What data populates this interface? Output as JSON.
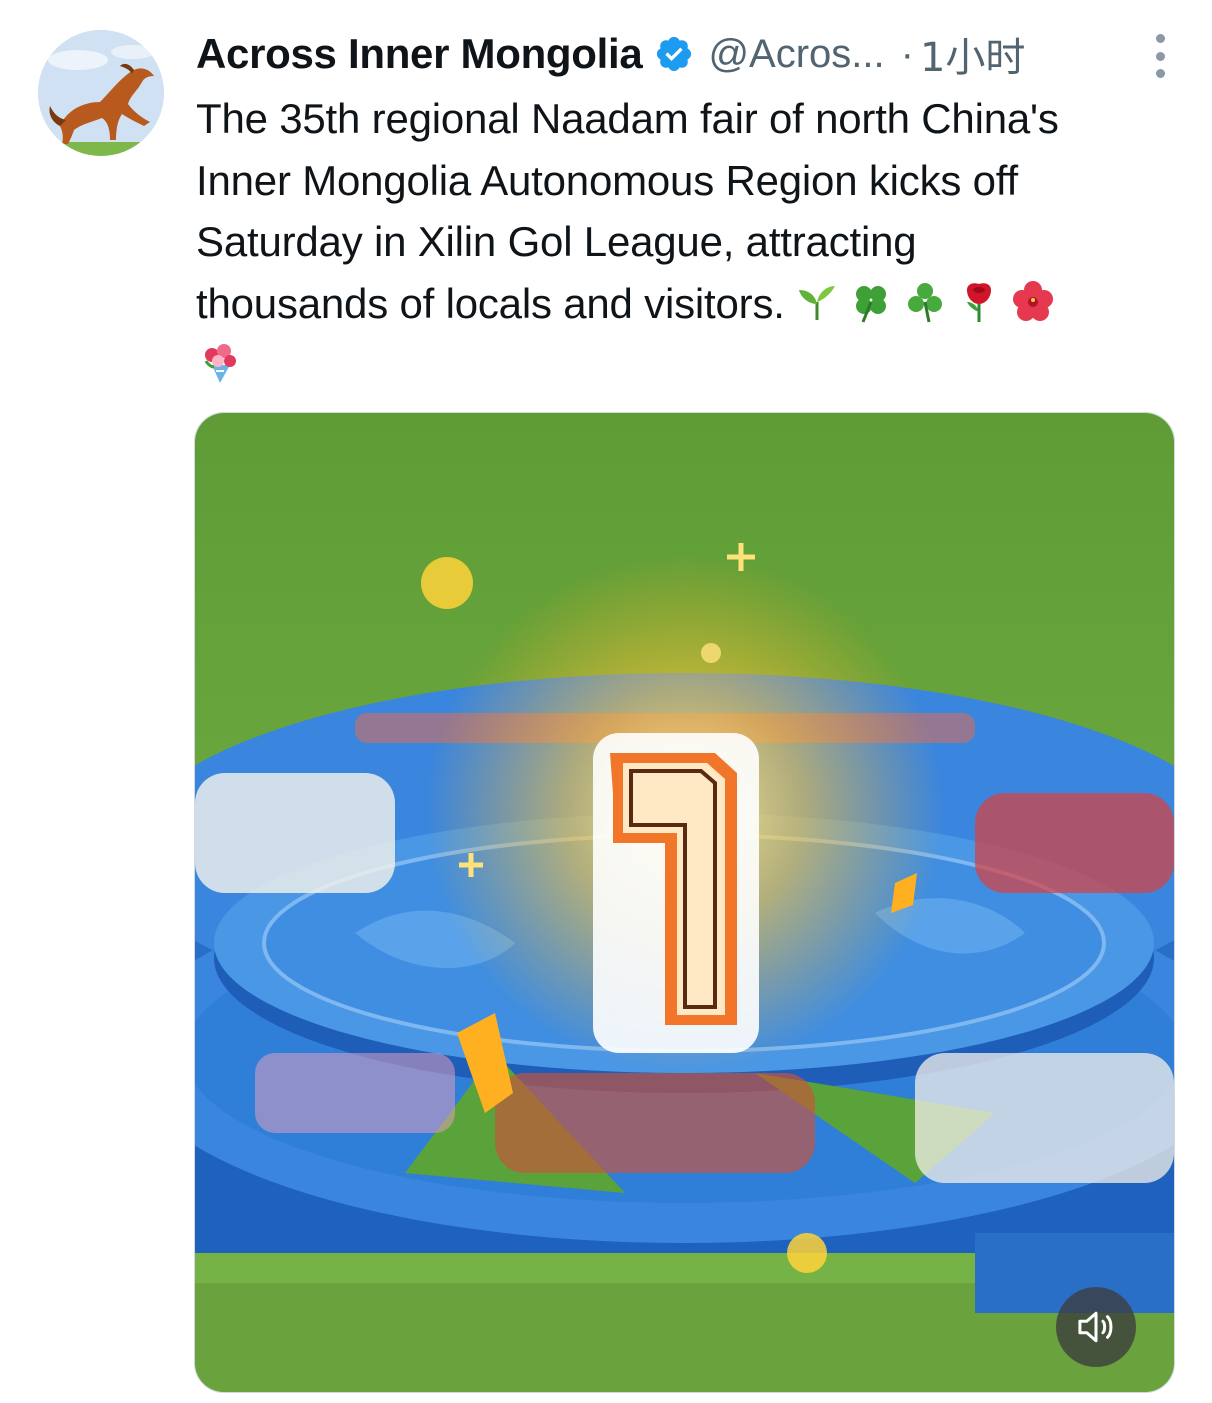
{
  "tweet": {
    "display_name": "Across Inner Mongolia",
    "handle": "@Acros...",
    "separator": "·",
    "time": "1小时",
    "text_lines": [
      "The 35th regional Naadam fair of north China's",
      "Inner Mongolia Autonomous Region kicks off",
      "Saturday in Xilin Gol League, attracting",
      "thousands of locals and visitors."
    ],
    "emojis": [
      "seedling-emoji",
      "four-leaf-clover-emoji",
      "shamrock-emoji",
      "rose-emoji",
      "hibiscus-emoji",
      "bouquet-emoji"
    ]
  },
  "media": {
    "type": "video",
    "overlay_number": "1",
    "muted_icon": "speaker-muted-icon"
  },
  "colors": {
    "verified": "#1d9bf0",
    "secondary_text": "#536471",
    "grass": "#6aa83c",
    "stage_blue": "#2f7fd8",
    "number_orange": "#f2762a"
  }
}
